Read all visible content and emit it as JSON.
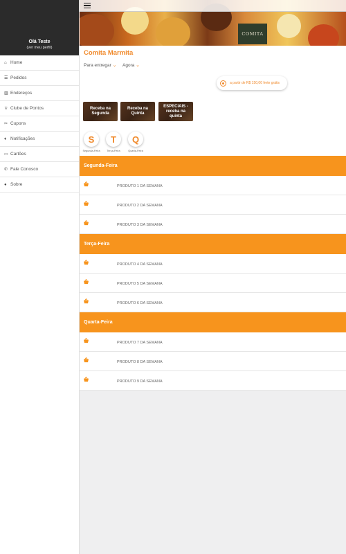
{
  "sidebar": {
    "profile": {
      "name": "Olá Teste",
      "link": "(ver meu perfil)"
    },
    "items": [
      {
        "label": "Home",
        "icon": "home-icon",
        "glyph": "⌂"
      },
      {
        "label": "Pedidos",
        "icon": "list-icon",
        "glyph": "☰"
      },
      {
        "label": "Endereços",
        "icon": "address-book-icon",
        "glyph": "▥"
      },
      {
        "label": "Clube de Pontos",
        "icon": "trophy-icon",
        "glyph": "♕"
      },
      {
        "label": "Cupons",
        "icon": "ticket-icon",
        "glyph": "✂"
      },
      {
        "label": "Notificações",
        "icon": "bell-icon",
        "glyph": "♦"
      },
      {
        "label": "Cartões",
        "icon": "credit-card-icon",
        "glyph": "▭"
      },
      {
        "label": "Fale Conosco",
        "icon": "chat-icon",
        "glyph": "✆"
      },
      {
        "label": "Sobre",
        "icon": "info-icon",
        "glyph": "●"
      }
    ]
  },
  "header": {
    "logo_text": "COMITA",
    "store_name": "Comita Marmita"
  },
  "delivery": {
    "mode": "Para entregar",
    "time": "Agora"
  },
  "promo": {
    "text": "a partir de R$ 150,00 frete grátis"
  },
  "categories": [
    {
      "label": "Receba na Segunda"
    },
    {
      "label": "Receba na Quinta"
    },
    {
      "label": "ESPECIAIS - receba na quinta"
    }
  ],
  "days": [
    {
      "letter": "S",
      "caption": "Segunda-Feira"
    },
    {
      "letter": "T",
      "caption": "Terça-Feira"
    },
    {
      "letter": "Q",
      "caption": "Quarta-Feira"
    }
  ],
  "sections": [
    {
      "title": "Segunda-Feira",
      "products": [
        "PRODUTO 1 DA SEMANA",
        "PRODUTO 2 DA SEMANA",
        "PRODUTO 3 DA SEMANA"
      ]
    },
    {
      "title": "Terça-Feira",
      "products": [
        "PRODUTO 4 DA SEMANA",
        "PRODUTO 5 DA SEMANA",
        "PRODUTO 6 DA SEMANA"
      ]
    },
    {
      "title": "Quarta-Feira",
      "products": [
        "PRODUTO 7 DA SEMANA",
        "PRODUTO 8 DA SEMANA",
        "PRODUTO 9 DA SEMANA"
      ]
    }
  ],
  "colors": {
    "accent": "#f7941d",
    "title": "#f0892a",
    "sidebar_header": "#2b2b2b"
  }
}
